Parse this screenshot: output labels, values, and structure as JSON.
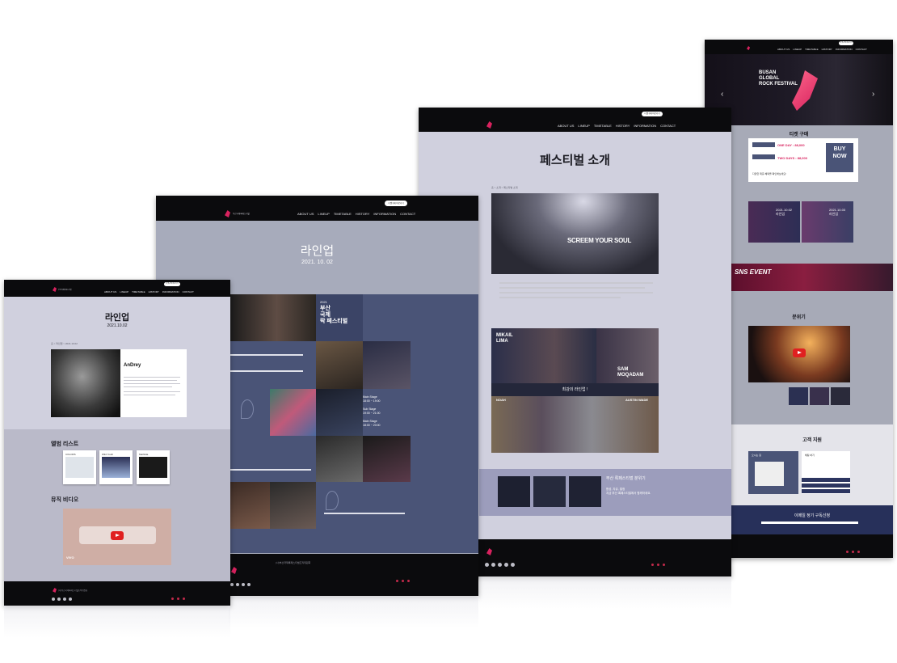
{
  "menu": [
    "ABOUT US",
    "LINEUP",
    "TIMETABLE",
    "HISTORY",
    "INFORMATION",
    "CONTACT"
  ],
  "ticket_pill": "티켓구매 바로가기",
  "logo_text": "부산국제록페스티벌",
  "footer_org": "(사)부산국제록페스티벌조직위원회",
  "win1": {
    "title": "라인업",
    "date": "2021.10.02",
    "breadcrumb": "홈 > 라인업 > 2021.10.02",
    "artist": "AnDrey",
    "album_heading": "앨범 리스트",
    "albums": [
      "COLORS",
      "Wild Youth",
      "Mathilda"
    ],
    "video_heading": "뮤직 비디오",
    "video_overlay": "VIVO"
  },
  "win2": {
    "title": "라인업",
    "date": "2021. 10. 02",
    "fest_year": "2021",
    "fest_name": "부산\n국제\n락 페스티벌",
    "stage1": "Main Stage",
    "time1": "18:00 ~ 19:00",
    "stage2": "Sub Stage",
    "time2": "19:00 ~ 21:00",
    "stage3": "Main Stage",
    "time3": "18:00 ~ 20:00"
  },
  "win3": {
    "title": "페스티벌 소개",
    "breadcrumb": "홈 > 소개 > 페스티벌 소개",
    "hero_text": "SCREEM YOUR SOUL",
    "names": [
      "MIKAIL LIMA",
      "SAM MOQADAM",
      "NOAH",
      "AUSTIN WADE"
    ],
    "lineup_caption": "최강의 라인업 !",
    "mood_title": "부산 록페스티벌 분위기",
    "mood_text": "함성, 자유, 열정\n지금 부산 록페스티벌에서 함께하세요."
  },
  "win4": {
    "hero_lines": [
      "BUSAN",
      "GLOBAL",
      "ROCK FESTIVAL"
    ],
    "ticket_heading": "티켓 구매",
    "one_day": "ONE DAY : 88,000",
    "two_days": "TWO DAYS : 88,000",
    "buy_now": "BUY\nNOW",
    "discount_note": "다양한 제휴 혜택을 확인해보세요!",
    "lineup_dates": [
      "2021.10.02\n라인업",
      "2021.10.03\n라인업"
    ],
    "sns_title": "SNS EVENT",
    "mood_heading": "분위기",
    "support_heading": "고객 지원",
    "map_label": "오시는 길",
    "contact_label": "채팅 하기",
    "subscribe_heading": "이메일 정기 구독신청"
  },
  "colors": {
    "accent": "#d8225e",
    "nav_bg": "#0b0b0d",
    "lavender": "#d0d0de",
    "navy": "#4a5477"
  }
}
